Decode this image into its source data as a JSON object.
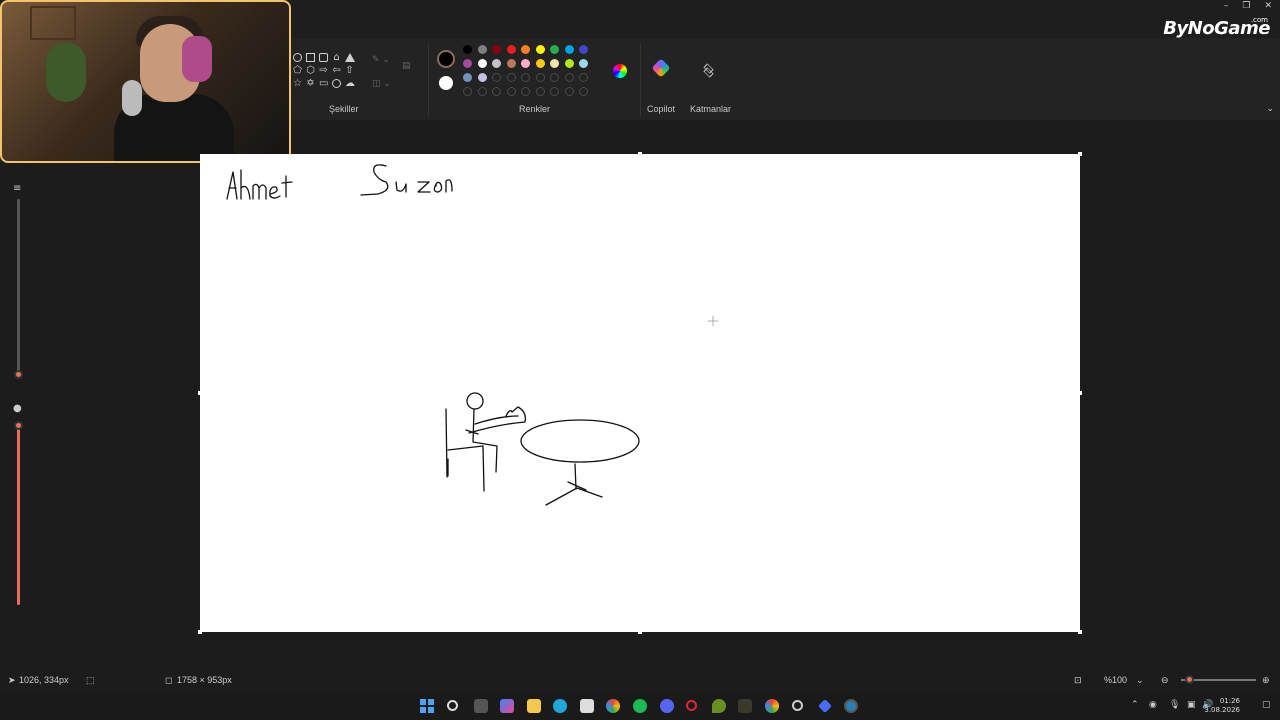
{
  "app": {
    "brand": "ByNoGame",
    "brand_suffix": ".com"
  },
  "ribbon": {
    "groups": {
      "shapes_label": "Şekiller",
      "colors_label": "Renkler",
      "copilot_label": "Copilot",
      "layers_label": "Katmanlar"
    },
    "current_color": "#000000",
    "secondary_color": "#ffffff",
    "swatch_rows": [
      [
        "#000000",
        "#7f7f7f",
        "#880015",
        "#ed1c24",
        "#ff7f27",
        "#fff200",
        "#22b14c",
        "#00a2e8",
        "#3f48cc"
      ],
      [
        "#a349a4",
        "#ffffff",
        "#c3c3c3",
        "#b97a57",
        "#ffaec9",
        "#ffc90e",
        "#efe4b0",
        "#b5e61d",
        "#99d9ea"
      ],
      [
        "#7092be",
        "#c8bfe7",
        "",
        "",
        "",
        "",
        "",
        "",
        ""
      ],
      [
        "",
        "",
        "",
        "",
        "",
        "",
        "",
        "",
        ""
      ]
    ]
  },
  "canvas": {
    "handwriting": {
      "name1": "Ahmet",
      "name2": "Suzan"
    }
  },
  "status": {
    "cursor_position": "1026, 334px",
    "canvas_size": "1758 × 953px",
    "zoom": "%100"
  },
  "taskbar": {
    "time": "01:26",
    "date": "3.08.2026"
  },
  "accent_color": "#e8705a"
}
